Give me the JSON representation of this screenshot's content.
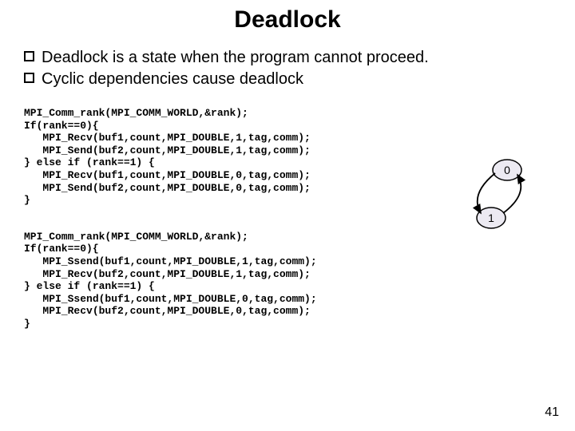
{
  "title": "Deadlock",
  "bullets": [
    "Deadlock is a state when the program cannot proceed.",
    "Cyclic dependencies cause deadlock"
  ],
  "code1": "MPI_Comm_rank(MPI_COMM_WORLD,&rank);\nIf(rank==0){\n   MPI_Recv(buf1,count,MPI_DOUBLE,1,tag,comm);\n   MPI_Send(buf2,count,MPI_DOUBLE,1,tag,comm);\n} else if (rank==1) {\n   MPI_Recv(buf1,count,MPI_DOUBLE,0,tag,comm);\n   MPI_Send(buf2,count,MPI_DOUBLE,0,tag,comm);\n}",
  "code2": "MPI_Comm_rank(MPI_COMM_WORLD,&rank);\nIf(rank==0){\n   MPI_Ssend(buf1,count,MPI_DOUBLE,1,tag,comm);\n   MPI_Recv(buf2,count,MPI_DOUBLE,1,tag,comm);\n} else if (rank==1) {\n   MPI_Ssend(buf1,count,MPI_DOUBLE,0,tag,comm);\n   MPI_Recv(buf2,count,MPI_DOUBLE,0,tag,comm);\n}",
  "diagram": {
    "node0": "0",
    "node1": "1"
  },
  "page_number": "41"
}
